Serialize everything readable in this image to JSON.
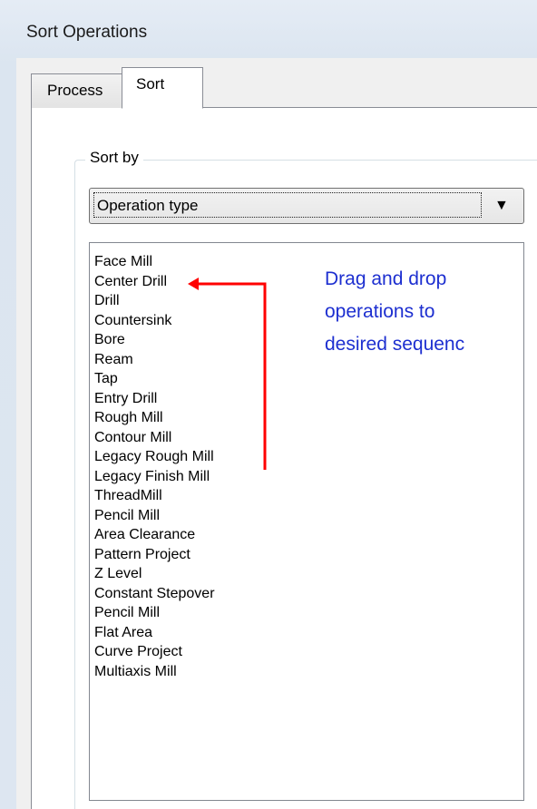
{
  "window": {
    "title": "Sort Operations"
  },
  "tabs": [
    {
      "label": "Process",
      "selected": false
    },
    {
      "label": "Sort",
      "selected": true
    }
  ],
  "sort_by": {
    "group_label": "Sort by",
    "selected_value": "Operation type",
    "arrow_icon": "chevron-down-icon"
  },
  "operations": [
    "Face Mill",
    "Center Drill",
    "Drill",
    "Countersink",
    "Bore",
    "Ream",
    "Tap",
    "Entry Drill",
    "Rough Mill",
    "Contour Mill",
    "Legacy Rough Mill",
    "Legacy Finish Mill",
    "ThreadMill",
    "Pencil Mill",
    "Area Clearance",
    "Pattern Project",
    "Z Level",
    "Constant Stepover",
    "Pencil Mill",
    "Flat Area",
    "Curve Project",
    "Multiaxis Mill"
  ],
  "annotation": {
    "lines": [
      "Drag and drop",
      "operations to",
      "desired sequenc"
    ],
    "color": "#1d2fd0",
    "arrow_color": "#ff0000"
  }
}
